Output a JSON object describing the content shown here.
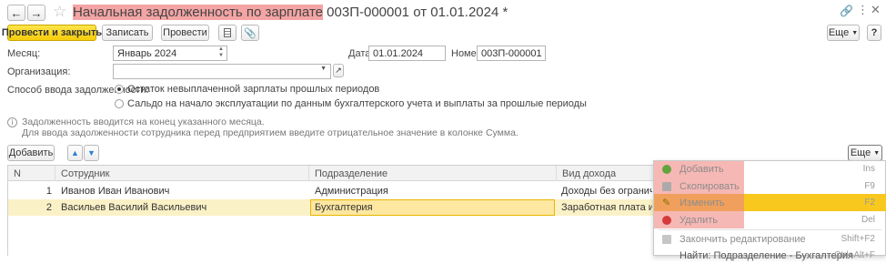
{
  "window": {
    "title_highlight": "Начальная задолженность по зарплате",
    "title_rest": "003П-000001 от 01.01.2024 *"
  },
  "toolbar": {
    "post_close": "Провести и закрыть",
    "save": "Записать",
    "post": "Провести",
    "more": "Еще",
    "help": "?"
  },
  "form": {
    "month_label": "Месяц:",
    "month_value": "Январь 2024",
    "date_label": "Дата:",
    "date_value": "01.01.2024",
    "number_label": "Номер:",
    "number_value": "003П-000001",
    "org_label": "Организация:",
    "org_value": "",
    "method_label": "Способ ввода задолженности:",
    "option1": "Остаток невыплаченной зарплаты прошлых периодов",
    "option2": "Сальдо на начало эксплуатации по данным бухгалтерского учета и выплаты за прошлые периоды",
    "info1": "Задолженность вводится на конец указанного месяца.",
    "info2": "Для ввода задолженности сотрудника перед предприятием введите отрицательное значение в колонке Сумма."
  },
  "table_toolbar": {
    "add": "Добавить",
    "more": "Еще"
  },
  "table": {
    "columns": [
      "N",
      "Сотрудник",
      "Подразделение",
      "Вид дохода"
    ],
    "rows": [
      [
        "1",
        "Иванов Иван Иванович",
        "Администрация",
        "Доходы без ограничения вз"
      ],
      [
        "2",
        "Васильев Василий Васильевич",
        "Бухгалтерия",
        "Заработная плата и иные д"
      ]
    ]
  },
  "context_menu": {
    "items": [
      {
        "label": "Добавить",
        "shortcut": "Ins",
        "icon": "add-icon"
      },
      {
        "label": "Скопировать",
        "shortcut": "F9",
        "icon": "copy-icon"
      },
      {
        "label": "Изменить",
        "shortcut": "F2",
        "icon": "pencil-icon"
      },
      {
        "label": "Удалить",
        "shortcut": "Del",
        "icon": "delete-icon"
      },
      {
        "label": "Закончить редактирование",
        "shortcut": "Shift+F2",
        "icon": "end-edit-icon"
      },
      {
        "label": "Найти: Подразделение - Бухгалтерия",
        "shortcut": "Ctrl+Alt+F",
        "icon": "find-icon"
      }
    ]
  },
  "colors": {
    "accent_yellow": "#f5cd0b",
    "title_highlight": "#f4a4a4",
    "selected_row": "#fbf1c7",
    "menu_highlight": "#f9c81f",
    "menu_red_highlight": "#f6b8b4"
  }
}
